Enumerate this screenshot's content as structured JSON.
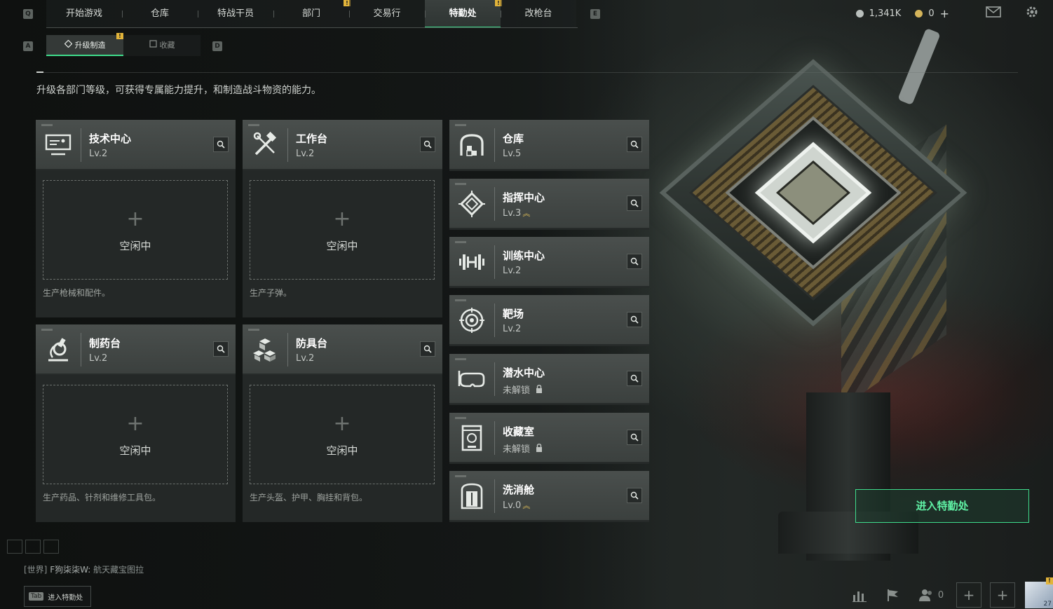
{
  "top_nav": {
    "key_left": "Q",
    "key_right": "E",
    "tabs": [
      {
        "label": "开始游戏",
        "active": false,
        "badge": ""
      },
      {
        "label": "仓库",
        "active": false,
        "badge": ""
      },
      {
        "label": "特战干员",
        "active": false,
        "badge": ""
      },
      {
        "label": "部门",
        "active": false,
        "badge": "!"
      },
      {
        "label": "交易行",
        "active": false,
        "badge": ""
      },
      {
        "label": "特勤处",
        "active": true,
        "badge": "!"
      },
      {
        "label": "改枪台",
        "active": false,
        "badge": ""
      }
    ],
    "currency_1": "1,341K",
    "currency_2": "0",
    "currency_2_add": "+"
  },
  "sub_nav": {
    "key_left": "A",
    "key_right": "D",
    "tabs": [
      {
        "label": "升级制造",
        "active": true,
        "badge": "!"
      },
      {
        "label": "收藏",
        "active": false,
        "badge": ""
      }
    ]
  },
  "description": "升级各部门等级，可获得专属能力提升，和制造战斗物资的能力。",
  "production_cards": [
    {
      "name": "技术中心",
      "level": "Lv.2",
      "icon": "monitor-icon",
      "plus": "+",
      "status": "空闲中",
      "desc": "生产枪械和配件。"
    },
    {
      "name": "工作台",
      "level": "Lv.2",
      "icon": "tools-icon",
      "plus": "+",
      "status": "空闲中",
      "desc": "生产子弹。"
    },
    {
      "name": "制药台",
      "level": "Lv.2",
      "icon": "microscope-icon",
      "plus": "+",
      "status": "空闲中",
      "desc": "生产药品、针剂和维修工具包。"
    },
    {
      "name": "防具台",
      "level": "Lv.2",
      "icon": "cubes-icon",
      "plus": "+",
      "status": "空闲中",
      "desc": "生产头盔、护甲、胸挂和背包。"
    }
  ],
  "facilities": [
    {
      "name": "仓库",
      "level": "Lv.5",
      "icon": "warehouse-icon",
      "upgrade": "",
      "locked": false
    },
    {
      "name": "指挥中心",
      "level": "Lv.3",
      "icon": "command-icon",
      "upgrade": "︽",
      "locked": false
    },
    {
      "name": "训练中心",
      "level": "Lv.2",
      "icon": "dumbbell-icon",
      "upgrade": "",
      "locked": false
    },
    {
      "name": "靶场",
      "level": "Lv.2",
      "icon": "target-icon",
      "upgrade": "",
      "locked": false
    },
    {
      "name": "潜水中心",
      "level": "未解锁",
      "icon": "diving-mask-icon",
      "upgrade": "",
      "locked": true
    },
    {
      "name": "收藏室",
      "level": "未解锁",
      "icon": "collection-icon",
      "upgrade": "",
      "locked": true
    },
    {
      "name": "洗消舱",
      "level": "Lv.0",
      "icon": "decon-icon",
      "upgrade": "︽",
      "locked": false
    }
  ],
  "enter_button": "进入特勤处",
  "chat": {
    "channel": "[世界]",
    "sender": "F狗柒柒W:",
    "message": "航天藏宝图拉"
  },
  "tab_hint": {
    "key": "Tab",
    "label": "进入特勤处"
  },
  "bottom_bar": {
    "friends_count": "0",
    "plus": "+",
    "avatar_badge": "!",
    "avatar_level": "27"
  },
  "colors": {
    "accent": "#3fdc8c",
    "badge": "#e2b43a",
    "upgrade": "#e3c15a"
  }
}
